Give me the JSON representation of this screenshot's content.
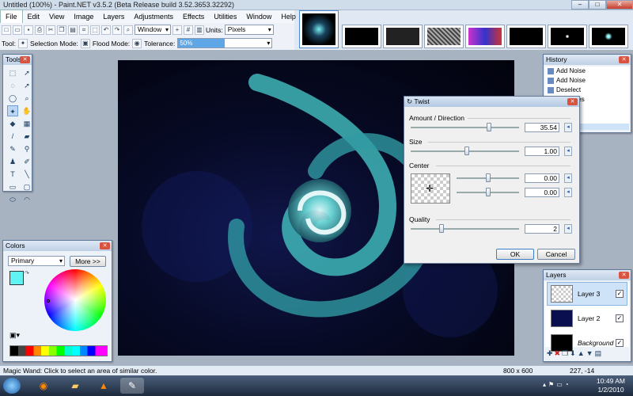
{
  "window": {
    "title": "Untitled (100%) - Paint.NET v3.5.2 (Beta Release build 3.52.3653.32292)"
  },
  "menu": [
    "File",
    "Edit",
    "View",
    "Image",
    "Layers",
    "Adjustments",
    "Effects",
    "Utilities",
    "Window",
    "Help"
  ],
  "toolbar": {
    "window_combo": "Window",
    "units_label": "Units:",
    "units_value": "Pixels",
    "tool_label": "Tool:",
    "selection_mode_label": "Selection Mode:",
    "flood_mode_label": "Flood Mode:",
    "tolerance_label": "Tolerance:",
    "tolerance_value": "50%",
    "tolerance_fraction": 0.5
  },
  "tools": {
    "title": "Tools"
  },
  "history": {
    "title": "History",
    "items": [
      "Add Noise",
      "Add Noise",
      "Deselect",
      "SinWaves",
      "",
      "",
      ""
    ]
  },
  "twist": {
    "title": "Twist",
    "amount": {
      "label": "Amount / Direction",
      "value": "35.54"
    },
    "size": {
      "label": "Size",
      "value": "1.00"
    },
    "center": {
      "label": "Center",
      "x": "0.00",
      "y": "0.00"
    },
    "quality": {
      "label": "Quality",
      "value": "2"
    },
    "ok": "OK",
    "cancel": "Cancel"
  },
  "colors": {
    "title": "Colors",
    "mode": "Primary",
    "more": "More >>",
    "primary": "#5ff3f3"
  },
  "layers": {
    "title": "Layers",
    "items": [
      "Layer 3",
      "Layer 2",
      "Background"
    ]
  },
  "status": {
    "hint": "Magic Wand: Click to select an area of similar color.",
    "size": "800 x 600",
    "pos": "227, -14"
  },
  "clock": {
    "time": "10:49 AM",
    "date": "1/2/2010"
  }
}
